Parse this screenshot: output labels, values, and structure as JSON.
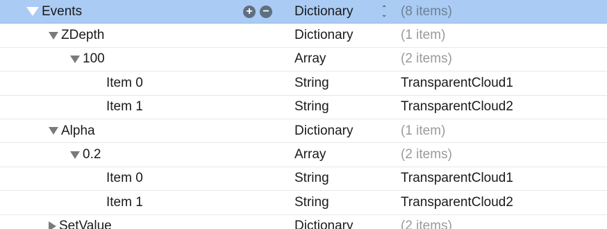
{
  "rows": [
    {
      "key": "Events",
      "type": "Dictionary",
      "value": "(8 items)",
      "expanded": true,
      "selected": true
    },
    {
      "key": "ZDepth",
      "type": "Dictionary",
      "value": "(1 item)",
      "expanded": true
    },
    {
      "key": "100",
      "type": "Array",
      "value": "(2 items)",
      "expanded": true
    },
    {
      "key": "Item 0",
      "type": "String",
      "value": "TransparentCloud1"
    },
    {
      "key": "Item 1",
      "type": "String",
      "value": "TransparentCloud2"
    },
    {
      "key": "Alpha",
      "type": "Dictionary",
      "value": "(1 item)",
      "expanded": true
    },
    {
      "key": "0.2",
      "type": "Array",
      "value": "(2 items)",
      "expanded": true
    },
    {
      "key": "Item 0",
      "type": "String",
      "value": "TransparentCloud1"
    },
    {
      "key": "Item 1",
      "type": "String",
      "value": "TransparentCloud2"
    },
    {
      "key": "SetValue",
      "type": "Dictionary",
      "value": "(2 items)",
      "expanded": false
    }
  ],
  "controls": {
    "add_symbol": "+",
    "remove_symbol": "−",
    "stepper_up": "⌃",
    "stepper_down": "⌄"
  },
  "colors": {
    "selection": "#aacbf3",
    "dim_value": "#9a9a9a",
    "disclosure": "#7a7a7a"
  }
}
